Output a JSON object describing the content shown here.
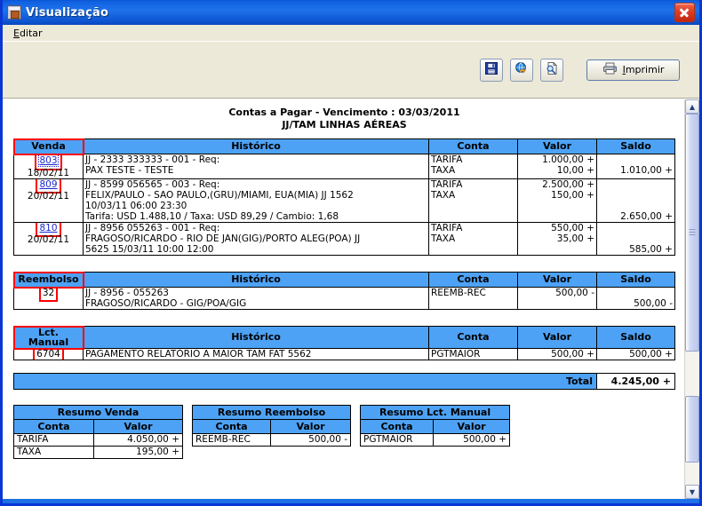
{
  "window": {
    "title": "Visualização",
    "icon": "app-window-icon",
    "close_label": "×"
  },
  "menu": {
    "items": [
      {
        "label": "Editar",
        "accel": "E"
      }
    ]
  },
  "toolbar": {
    "buttons": [
      {
        "name": "save-button",
        "icon": "floppy-disk-icon",
        "tooltip": "Salvar"
      },
      {
        "name": "export-button",
        "icon": "globe-export-icon",
        "tooltip": "Exportar"
      },
      {
        "name": "preview-button",
        "icon": "page-magnifier-icon",
        "tooltip": "Visualizar"
      }
    ],
    "print": {
      "label": "Imprimir",
      "accel": "I",
      "icon": "printer-icon"
    }
  },
  "report": {
    "title_line1": "Contas a Pagar - Vencimento : 03/03/2011",
    "title_line2": "JJ/TAM LINHAS AÉREAS",
    "sections": [
      {
        "key": "venda",
        "headers": [
          "Venda",
          "Histórico",
          "Conta",
          "Valor",
          "Saldo"
        ],
        "rows": [
          {
            "number": "803",
            "date": "18/02/11",
            "link": true,
            "focused": true,
            "historico": [
              "JJ - 2333    333333 - 001  - Req:",
              "PAX TESTE - TESTE"
            ],
            "contas": [
              "TARIFA",
              "TAXA"
            ],
            "valores": [
              "1.000,00 +",
              "10,00 +"
            ],
            "saldos": [
              "",
              "1.010,00 +"
            ]
          },
          {
            "number": "809",
            "date": "20/02/11",
            "link": true,
            "focused": false,
            "historico": [
              "JJ - 8599    056565 - 003  - Req:",
              "FELIX/PAULO - SAO PAULO,(GRU)/MIAMI, EUA(MIA) JJ 1562",
              "10/03/11 06:00 23:30",
              "Tarifa: USD 1.488,10 / Taxa: USD 89,29 / Cambio:  1,68"
            ],
            "contas": [
              "TARIFA",
              "TAXA"
            ],
            "valores": [
              "2.500,00 +",
              "150,00 +"
            ],
            "saldos": [
              "",
              "",
              "",
              "2.650,00 +"
            ]
          },
          {
            "number": "810",
            "date": "20/02/11",
            "link": true,
            "focused": false,
            "historico": [
              "JJ - 8956    055263 - 001  - Req:",
              "FRAGOSO/RICARDO - RIO DE JAN(GIG)/PORTO ALEG(POA) JJ",
              "5625 15/03/11 10:00 12:00"
            ],
            "contas": [
              "TARIFA",
              "TAXA"
            ],
            "valores": [
              "550,00 +",
              "35,00 +"
            ],
            "saldos": [
              "",
              "",
              "585,00 +"
            ]
          }
        ]
      },
      {
        "key": "reembolso",
        "headers": [
          "Reembolso",
          "Histórico",
          "Conta",
          "Valor",
          "Saldo"
        ],
        "rows": [
          {
            "number": "32",
            "date": "",
            "link": false,
            "focused": false,
            "historico": [
              "JJ - 8956 -  055263",
              "FRAGOSO/RICARDO - GIG/POA/GIG"
            ],
            "contas": [
              "REEMB-REC"
            ],
            "valores": [
              "500,00 -"
            ],
            "saldos": [
              "",
              "500,00 -"
            ]
          }
        ]
      },
      {
        "key": "lct_manual",
        "headers": [
          "Lct.\nManual",
          "Histórico",
          "Conta",
          "Valor",
          "Saldo"
        ],
        "header_line1": "Lct.",
        "header_line2": "Manual",
        "rows": [
          {
            "number": "6704",
            "date": "",
            "link": false,
            "focused": false,
            "historico": [
              "PAGAMENTO RELATÓRIO A MAIOR TAM FAT 5562"
            ],
            "contas": [
              "PGTMAIOR"
            ],
            "valores": [
              "500,00 +"
            ],
            "saldos": [
              "500,00 +"
            ]
          }
        ]
      }
    ],
    "total": {
      "label": "Total",
      "value": "4.245,00 +"
    },
    "summaries": [
      {
        "title": "Resumo Venda",
        "headers": [
          "Conta",
          "Valor"
        ],
        "rows": [
          [
            "TARIFA",
            "4.050,00 +"
          ],
          [
            "TAXA",
            "195,00 +"
          ]
        ]
      },
      {
        "title": "Resumo Reembolso",
        "headers": [
          "Conta",
          "Valor"
        ],
        "rows": [
          [
            "REEMB-REC",
            "500,00 -"
          ]
        ]
      },
      {
        "title": "Resumo Lct. Manual",
        "headers": [
          "Conta",
          "Valor"
        ],
        "rows": [
          [
            "PGTMAIOR",
            "500,00 +"
          ]
        ]
      }
    ]
  },
  "colors": {
    "header_blue": "#4da2f5",
    "title_blue": "#1162e0",
    "highlight_red": "#ff0000",
    "link_blue": "#1a28d0",
    "toolbar_bg": "#ece9d8"
  }
}
